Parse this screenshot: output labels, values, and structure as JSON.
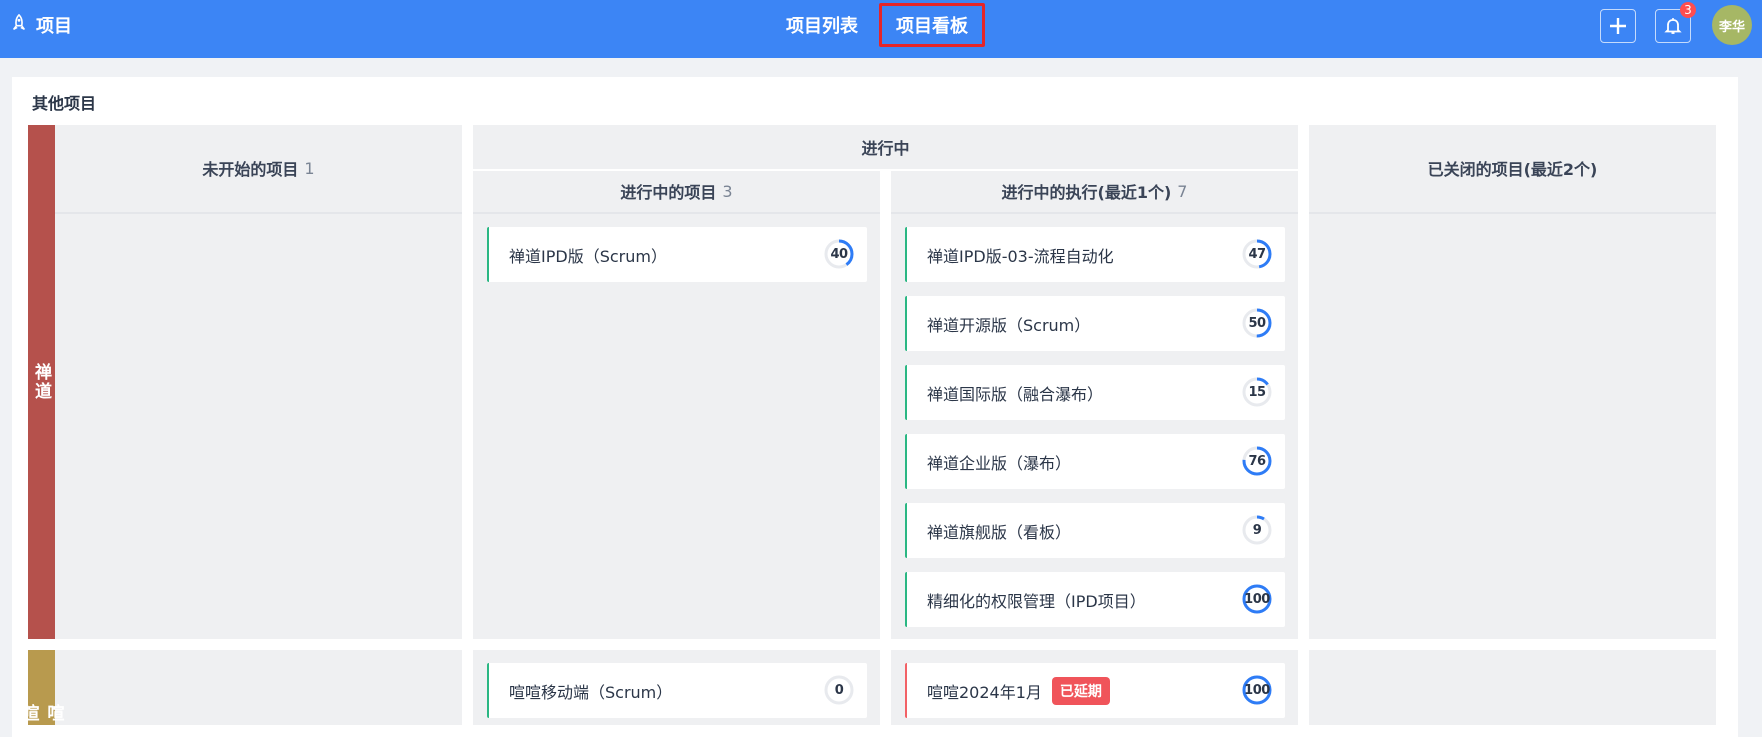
{
  "header": {
    "brand_label": "项目",
    "nav_list_label": "项目列表",
    "nav_kanban_label": "项目看板",
    "notification_count": "3",
    "avatar_label": "李华"
  },
  "section": {
    "title": "其他项目"
  },
  "columns": {
    "not_started": {
      "label": "未开始的项目",
      "count": "1"
    },
    "in_progress_group": {
      "label": "进行中"
    },
    "in_progress_projects": {
      "label": "进行中的项目",
      "count": "3"
    },
    "in_progress_executions": {
      "label": "进行中的执行(最近1个)",
      "count": "7"
    },
    "closed": {
      "label": "已关闭的项目(最近2个)"
    }
  },
  "lanes": [
    {
      "label": "禅道",
      "color": "#b5514c",
      "projects": [
        {
          "name": "禅道IPD版（Scrum）",
          "progress": 40
        }
      ],
      "executions": [
        {
          "name": "禅道IPD版-03-流程自动化",
          "progress": 47
        },
        {
          "name": "禅道开源版（Scrum）",
          "progress": 50
        },
        {
          "name": "禅道国际版（融合瀑布）",
          "progress": 15
        },
        {
          "name": "禅道企业版（瀑布）",
          "progress": 76
        },
        {
          "name": "禅道旗舰版（看板）",
          "progress": 9
        },
        {
          "name": "精细化的权限管理（IPD项目）",
          "progress": 100
        }
      ]
    },
    {
      "label": "喧喧",
      "color": "#b89a4e",
      "projects": [
        {
          "name": "喧喧移动端（Scrum）",
          "progress": 0
        }
      ],
      "executions": [
        {
          "name": "喧喧2024年1月",
          "progress": 100,
          "tag": "已延期"
        }
      ]
    }
  ],
  "colors": {
    "header": "#3c85f5",
    "accent": "#2e7cf6",
    "ok_border": "#2ab783",
    "delay": "#f0545a"
  }
}
